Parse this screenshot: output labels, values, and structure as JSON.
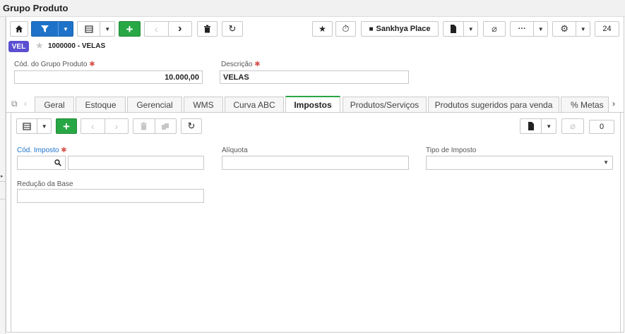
{
  "window": {
    "title": "Grupo Produto"
  },
  "toolbar": {
    "sankhya_place_label": "Sankhya Place",
    "counter": "24"
  },
  "record": {
    "badge": "VEL",
    "title": "1000000 - VELAS"
  },
  "form": {
    "cod_grupo": {
      "label": "Cód. do Grupo Produto",
      "value": "10.000,00"
    },
    "descricao": {
      "label": "Descrição",
      "value": "VELAS"
    }
  },
  "tabs": [
    {
      "label": "Geral"
    },
    {
      "label": "Estoque"
    },
    {
      "label": "Gerencial"
    },
    {
      "label": "WMS"
    },
    {
      "label": "Curva ABC"
    },
    {
      "label": "Impostos"
    },
    {
      "label": "Produtos/Serviços"
    },
    {
      "label": "Produtos sugeridos para venda"
    },
    {
      "label": "% Metas"
    }
  ],
  "active_tab": "Impostos",
  "subtoolbar": {
    "counter": "0"
  },
  "impostos": {
    "cod_imposto": {
      "label": "Cód. Imposto",
      "value": "",
      "description": ""
    },
    "aliquota": {
      "label": "Alíquota",
      "value": ""
    },
    "tipo_imposto": {
      "label": "Tipo de Imposto",
      "value": ""
    },
    "reducao_base": {
      "label": "Redução da Base",
      "value": ""
    }
  },
  "colors": {
    "primary": "#1e73c9",
    "success": "#28a745",
    "badge": "#5b4fd1",
    "required": "#d9534f"
  }
}
